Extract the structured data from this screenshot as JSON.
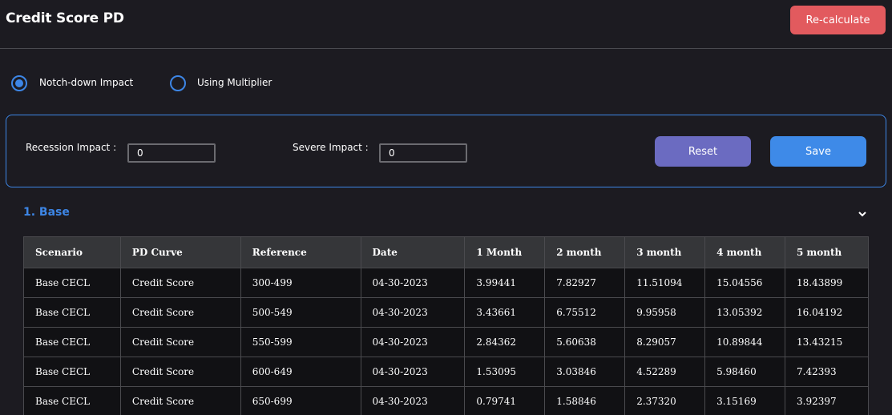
{
  "header": {
    "title": "Credit Score PD",
    "recalculate_label": "Re-calculate",
    "colors": {
      "recalculate": "#e25a5e",
      "accent": "#3d86e6"
    }
  },
  "mode_options": [
    {
      "label": "Notch-down Impact",
      "selected": true
    },
    {
      "label": "Using Multiplier",
      "selected": false
    }
  ],
  "impact_panel": {
    "recession_label": "Recession Impact :",
    "recession_value": "0",
    "severe_label": "Severe Impact :",
    "severe_value": "0",
    "reset_label": "Reset",
    "save_label": "Save"
  },
  "section": {
    "title": "1. Base",
    "expand_icon": "chevron-down-icon"
  },
  "table": {
    "columns": [
      "Scenario",
      "PD Curve",
      "Reference",
      "Date",
      "1 Month",
      "2 month",
      "3 month",
      "4 month",
      "5 month"
    ],
    "rows": [
      [
        "Base CECL",
        "Credit Score",
        "300-499",
        "04-30-2023",
        "3.99441",
        "7.82927",
        "11.51094",
        "15.04556",
        "18.43899"
      ],
      [
        "Base CECL",
        "Credit Score",
        "500-549",
        "04-30-2023",
        "3.43661",
        "6.75512",
        "9.95958",
        "13.05392",
        "16.04192"
      ],
      [
        "Base CECL",
        "Credit Score",
        "550-599",
        "04-30-2023",
        "2.84362",
        "5.60638",
        "8.29057",
        "10.89844",
        "13.43215"
      ],
      [
        "Base CECL",
        "Credit Score",
        "600-649",
        "04-30-2023",
        "1.53095",
        "3.03846",
        "4.52289",
        "5.98460",
        "7.42393"
      ],
      [
        "Base CECL",
        "Credit Score",
        "650-699",
        "04-30-2023",
        "0.79741",
        "1.58846",
        "2.37320",
        "3.15169",
        "3.92397"
      ]
    ]
  }
}
